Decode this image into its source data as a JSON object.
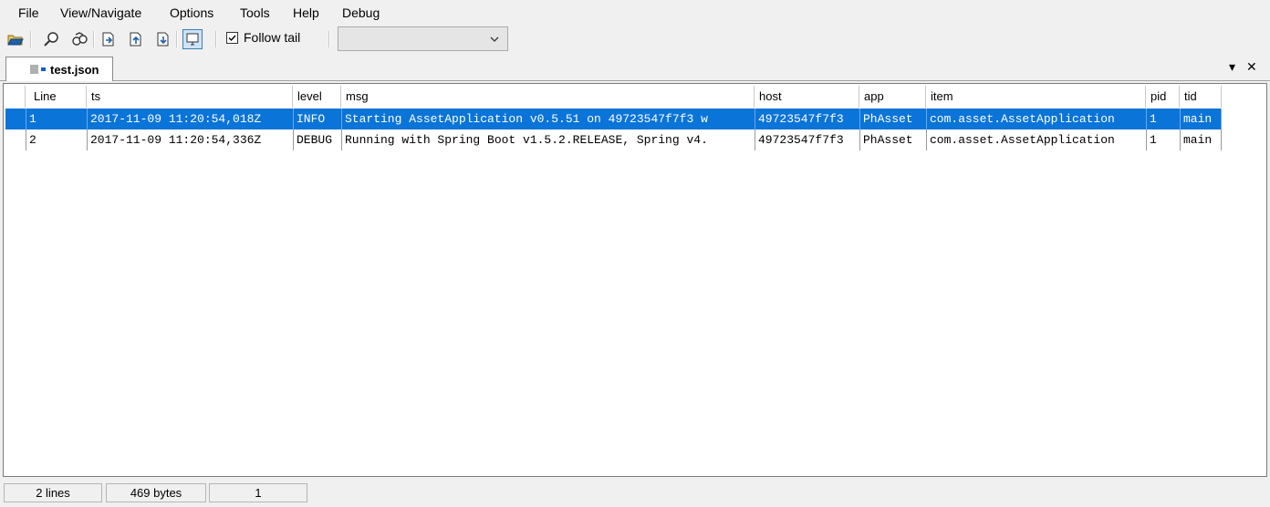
{
  "menu": [
    "File",
    "View/Navigate",
    "Options",
    "Tools",
    "Help",
    "Debug"
  ],
  "toolbar": {
    "follow_tail_label": "Follow tail",
    "follow_tail_checked": true,
    "filter_value": ""
  },
  "tab": {
    "label": "test.json",
    "dropdown_glyph": "▾",
    "close_glyph": "✕"
  },
  "table": {
    "columns": [
      "Line",
      "ts",
      "level",
      "msg",
      "host",
      "app",
      "item",
      "pid",
      "tid"
    ],
    "rows": [
      [
        "1",
        "2017-11-09 11:20:54,018Z",
        "INFO",
        "Starting AssetApplication v0.5.51 on 49723547f7f3 w",
        "49723547f7f3",
        "PhAsset",
        "com.asset.AssetApplication",
        "1",
        "main"
      ],
      [
        "2",
        "2017-11-09 11:20:54,336Z",
        "DEBUG",
        "Running with Spring Boot v1.5.2.RELEASE, Spring v4.",
        "49723547f7f3",
        "PhAsset",
        "com.asset.AssetApplication",
        "1",
        "main"
      ]
    ],
    "selected_row": 0
  },
  "status": {
    "lines": "2 lines",
    "bytes": "469 bytes",
    "current": "1"
  },
  "colors": {
    "selection": "#0a74d9",
    "chrome": "#f0f0f0"
  }
}
